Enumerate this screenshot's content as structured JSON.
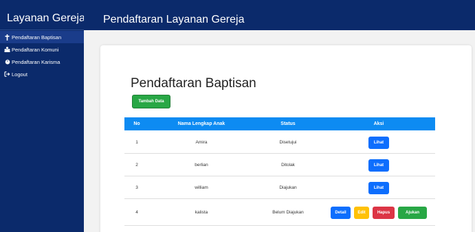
{
  "sidebar": {
    "brand": "Layanan Gereja",
    "items": [
      {
        "label": "Pendaftaran Baptisan",
        "icon": "cross-icon"
      },
      {
        "label": "Pendaftaran Komuni",
        "icon": "people-icon"
      },
      {
        "label": "Pendaftaran Karisma",
        "icon": "power-icon"
      },
      {
        "label": "Logout",
        "icon": "logout-icon"
      }
    ]
  },
  "header": {
    "title": "Pendaftaran Layanan Gereja"
  },
  "main": {
    "title": "Pendaftaran Baptisan",
    "add_button": "Tambah Data",
    "columns": [
      "No",
      "Nama Lengkap Anak",
      "Status",
      "Aksi"
    ],
    "rows": [
      {
        "no": "1",
        "name": "Amira",
        "status": "Disetujui",
        "actions": [
          "Lihat"
        ]
      },
      {
        "no": "2",
        "name": "berlian",
        "status": "Ditolak",
        "actions": [
          "Lihat"
        ]
      },
      {
        "no": "3",
        "name": "william",
        "status": "Diajukan",
        "actions": [
          "Lihat"
        ]
      },
      {
        "no": "4",
        "name": "kalista",
        "status": "Belum Diajukan",
        "actions": [
          "Detail",
          "Edit",
          "Hapus",
          "Ajukan"
        ]
      }
    ]
  },
  "colors": {
    "navy": "#0b2a6b",
    "table_header": "#0d8bf2",
    "primary": "#0d6efd",
    "success": "#28a745",
    "warning": "#ffc107",
    "danger": "#dc3545"
  }
}
